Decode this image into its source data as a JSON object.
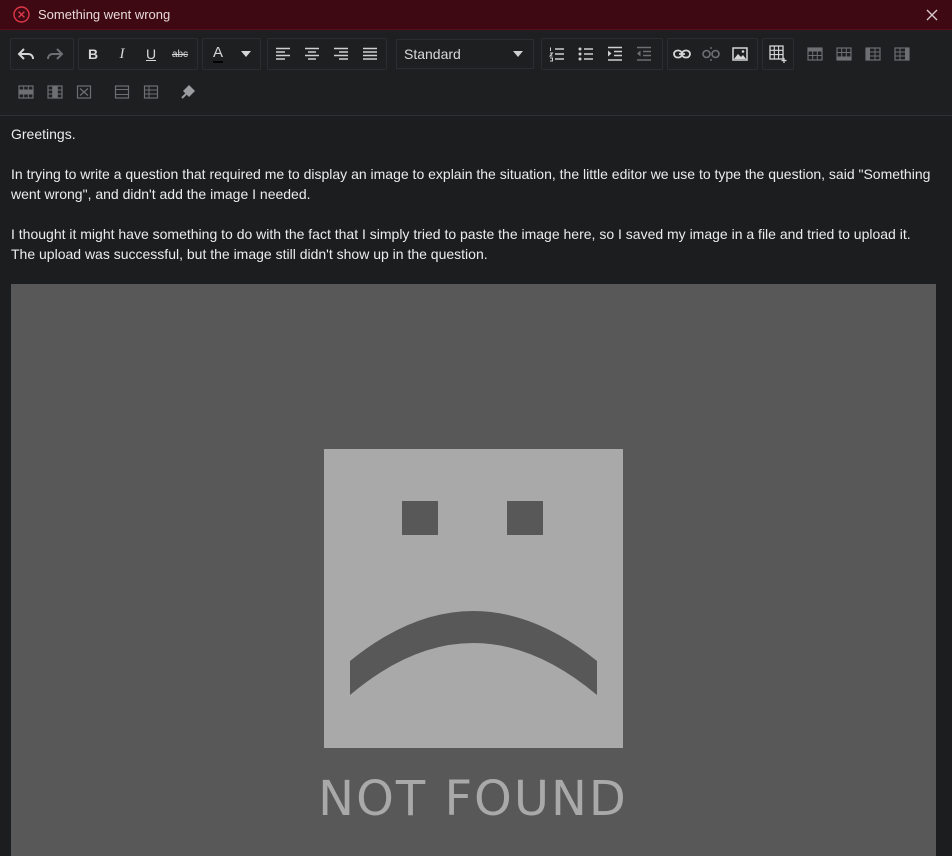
{
  "error_banner": {
    "message": "Something went wrong",
    "icon": "error-circle-x-icon",
    "close_icon": "close-icon",
    "colors": {
      "background": "#3e0912",
      "icon": "#e0384a"
    }
  },
  "toolbar": {
    "style_select": {
      "value": "Standard"
    },
    "text_color_letter": "A",
    "bold_letter": "B",
    "italic_letter": "I",
    "underline_letter": "U",
    "strike_label": "abc"
  },
  "content": {
    "paragraphs": [
      "Greetings.",
      "In trying to write a question that required me to display an image to explain the situation, the little editor we use to type the question, said \"Something went wrong\", and didn't add the image I needed.",
      "I thought it might have something to do with the fact that I simply tried to paste the image here, so I saved my image in a file and tried to upload it. The upload was successful, but the image still didn't show up in the question."
    ],
    "image_placeholder": {
      "caption": "NOT FOUND",
      "colors": {
        "background": "#585858",
        "face": "#a9a9a9"
      }
    }
  }
}
